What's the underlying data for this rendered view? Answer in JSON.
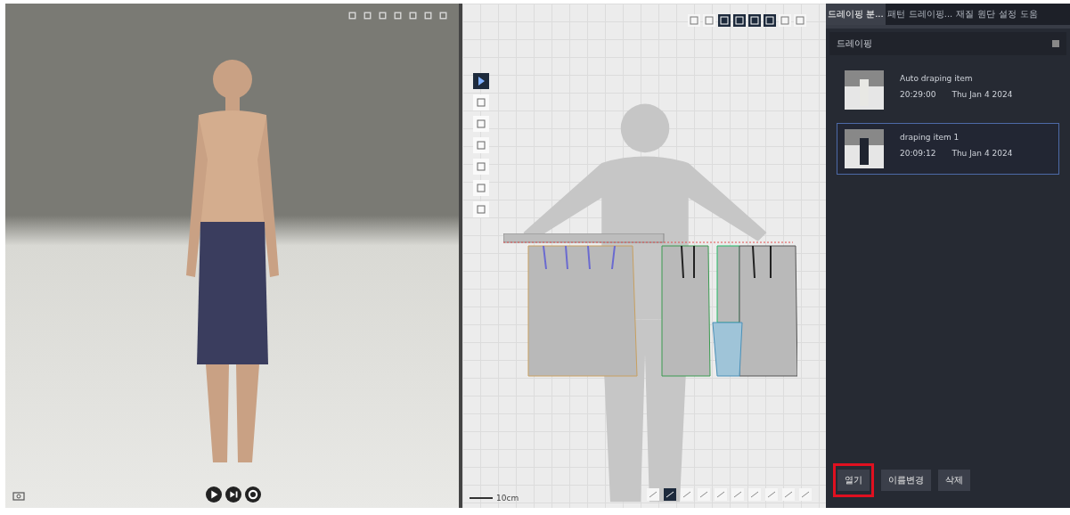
{
  "pattern_canvas": {
    "scale_label": "10cm"
  },
  "side_panel": {
    "tabs": [
      {
        "label": "드레이핑 분...",
        "selected": true
      },
      {
        "label": "패턴",
        "selected": false
      },
      {
        "label": "드레이핑...",
        "selected": false
      },
      {
        "label": "재질",
        "selected": false
      },
      {
        "label": "원단",
        "selected": false
      },
      {
        "label": "설정",
        "selected": false
      },
      {
        "label": "도움",
        "selected": false
      }
    ],
    "header": "드레이핑",
    "items": [
      {
        "name": "Auto draping item",
        "time": "20:29:00",
        "date": "Thu Jan 4 2024",
        "selected": false,
        "kind": "white"
      },
      {
        "name": "draping item 1",
        "time": "20:09:12",
        "date": "Thu Jan 4 2024",
        "selected": true,
        "kind": "dark"
      }
    ],
    "buttons": [
      {
        "label": "열기",
        "highlighted": true
      },
      {
        "label": "이름변경",
        "highlighted": false
      },
      {
        "label": "삭제",
        "highlighted": false
      }
    ]
  }
}
